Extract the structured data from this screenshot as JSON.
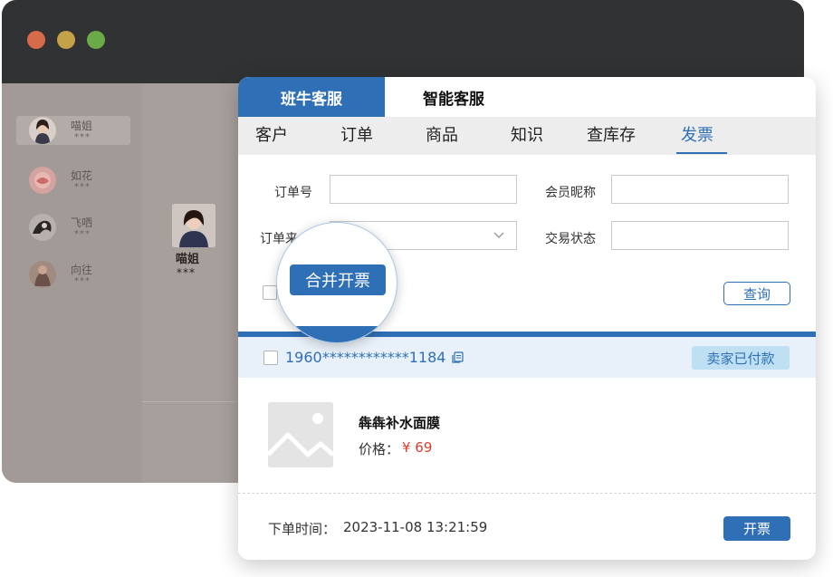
{
  "window": {
    "traffic_lights": [
      "close",
      "minimize",
      "maximize"
    ]
  },
  "contacts": [
    {
      "name": "喵姐",
      "sub": "***",
      "active": true
    },
    {
      "name": "如花",
      "sub": "***",
      "active": false
    },
    {
      "name": "飞哂",
      "sub": "***",
      "active": false
    },
    {
      "name": "向往",
      "sub": "***",
      "active": false
    }
  ],
  "chat": {
    "name": "喵姐",
    "sub": "***"
  },
  "panel": {
    "tabs": [
      "班牛客服",
      "智能客服"
    ],
    "subnav": [
      "客户",
      "订单",
      "商品",
      "知识",
      "查库存",
      "发票"
    ],
    "active_subnav": "发票",
    "form": {
      "order_no_label": "订单号",
      "order_no_value": "",
      "member_label": "会员昵称",
      "member_value": "",
      "source_label": "订单来",
      "source_value": "",
      "status_label": "交易状态",
      "status_value": ""
    },
    "query_label": "查询",
    "merge_label": "合并开票",
    "order": {
      "number": "1960************1184",
      "status": "卖家已付款",
      "product_name": "犇犇补水面膜",
      "price_label": "价格：",
      "price": "¥ 69",
      "time_label": "下单时间：",
      "time": "2023-11-08 13:21:59",
      "invoice_label": "开票"
    }
  },
  "colors": {
    "accent": "#2f6fb6",
    "price": "#e03b2f",
    "status_badge_bg": "#bfe0f2",
    "titlebar": "#313233"
  },
  "icons": {
    "copy": "copy-icon",
    "chevron": "chevron-down-icon",
    "image_placeholder": "image-placeholder-icon"
  }
}
